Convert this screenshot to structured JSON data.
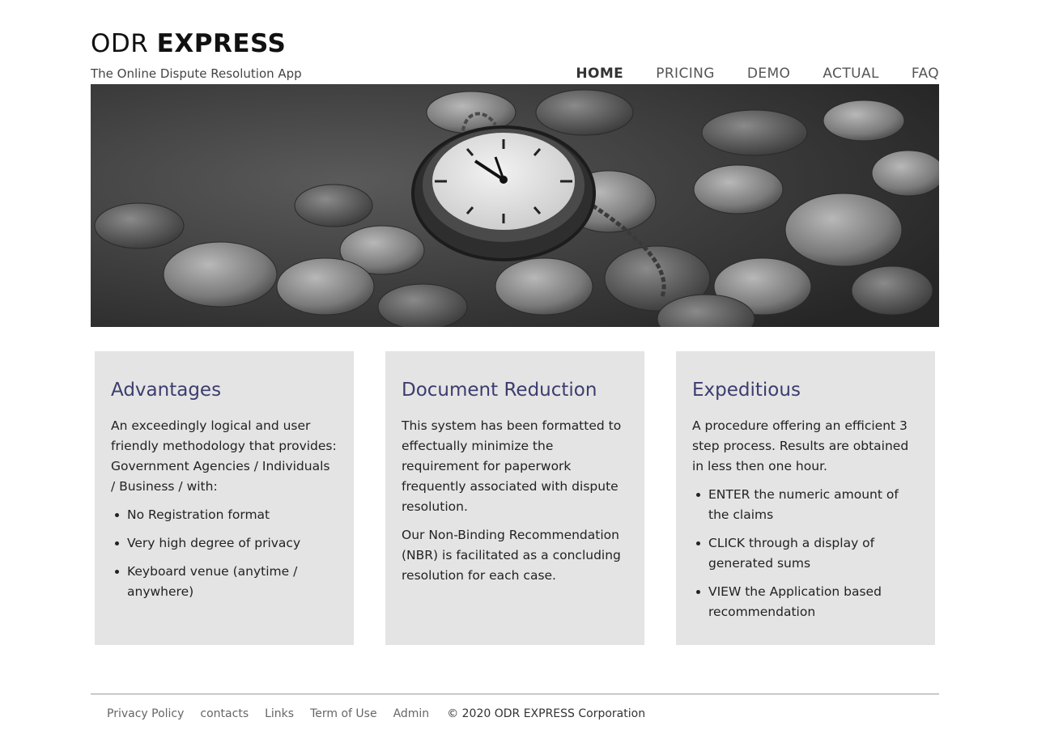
{
  "header": {
    "title_light": "ODR ",
    "title_bold": "EXPRESS",
    "tagline": "The Online Dispute Resolution App"
  },
  "nav": {
    "items": [
      "HOME",
      "PRICING",
      "DEMO",
      "ACTUAL",
      "FAQ"
    ],
    "active": "HOME"
  },
  "hero": {
    "icons": [
      "pocket-watch-icon",
      "coins-icon"
    ]
  },
  "cards": [
    {
      "title": "Advantages",
      "paragraphs": [
        "An exceedingly logical and user friendly methodology that provides: Government Agencies / Individuals / Business / with:"
      ],
      "bullets": [
        "No Registration format",
        "Very high degree of privacy",
        "Keyboard venue (anytime / anywhere)"
      ]
    },
    {
      "title": "Document Reduction",
      "paragraphs": [
        "This system has been formatted to effectually minimize the requirement for paperwork frequently associated with dispute resolution.",
        "Our Non-Binding Recommendation (NBR) is facilitated as a concluding resolution for each case."
      ],
      "bullets": []
    },
    {
      "title": "Expeditious",
      "paragraphs": [
        "A procedure offering an efficient 3 step process. Results are obtained in less then one hour."
      ],
      "bullets": [
        "ENTER the numeric amount of the claims",
        "CLICK through a display of generated sums",
        "VIEW the Application based recommendation"
      ]
    }
  ],
  "footer": {
    "links": [
      "Privacy Policy",
      "contacts",
      "Links",
      "Term of Use",
      "Admin"
    ],
    "copyright": "© 2020 ODR EXPRESS Corporation"
  },
  "colors": {
    "card_bg": "#e4e4e4",
    "card_title": "#3c3c6e",
    "nav_text": "#555555"
  }
}
